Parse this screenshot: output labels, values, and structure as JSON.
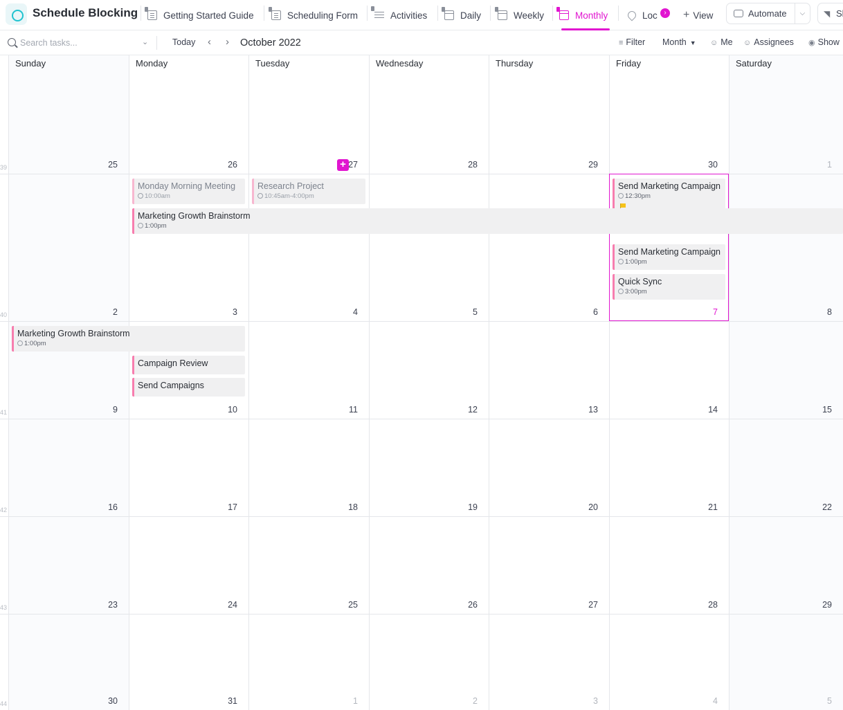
{
  "header": {
    "space_title": "Schedule Blocking",
    "tabs": [
      {
        "label": "Getting Started Guide"
      },
      {
        "label": "Scheduling Form"
      },
      {
        "label": "Activities"
      },
      {
        "label": "Daily"
      },
      {
        "label": "Weekly"
      },
      {
        "label": "Monthly",
        "active": true
      },
      {
        "label": "Loc"
      }
    ],
    "more_badge": "›",
    "add_view_label": "View",
    "automate_label": "Automate",
    "share_label": "Sh"
  },
  "toolbar": {
    "search_placeholder": "Search tasks...",
    "today_label": "Today",
    "month_title": "October 2022",
    "filter_label": "Filter",
    "period_label": "Month",
    "me_label": "Me",
    "assignees_label": "Assignees",
    "show_label": "Show"
  },
  "calendar": {
    "weekdays": [
      "Sunday",
      "Monday",
      "Tuesday",
      "Wednesday",
      "Thursday",
      "Friday",
      "Saturday"
    ],
    "week_numbers": [
      "39",
      "40",
      "41",
      "42",
      "43",
      "44"
    ],
    "weeks": [
      [
        "25",
        "26",
        "27",
        "28",
        "29",
        "30",
        "1"
      ],
      [
        "2",
        "3",
        "4",
        "5",
        "6",
        "7",
        "8"
      ],
      [
        "9",
        "10",
        "11",
        "12",
        "13",
        "14",
        "15"
      ],
      [
        "16",
        "17",
        "18",
        "19",
        "20",
        "21",
        "22"
      ],
      [
        "23",
        "24",
        "25",
        "26",
        "27",
        "28",
        "29"
      ],
      [
        "30",
        "31",
        "1",
        "2",
        "3",
        "4",
        "5"
      ]
    ],
    "today": "7"
  },
  "events": [
    {
      "title": "Monday Morning Meeting",
      "time": "10:00am",
      "past": true
    },
    {
      "title": "Research Project",
      "time": "10:45am-4:00pm",
      "past": true
    },
    {
      "title": "Send Marketing Campaign",
      "time": "12:30pm",
      "flag": "priority-flag-yellow"
    },
    {
      "title": "Marketing Growth Brainstorm",
      "time": "1:00pm"
    },
    {
      "title": "Send Marketing Campaign",
      "time": "1:00pm"
    },
    {
      "title": "Quick Sync",
      "time": "3:00pm"
    },
    {
      "title": "Marketing Growth Brainstorm",
      "time": "1:00pm"
    },
    {
      "title": "Campaign Review",
      "time": ""
    },
    {
      "title": "Send Campaigns",
      "time": ""
    }
  ],
  "colors": {
    "accent": "#e115d0",
    "event_bar": "#f77dae",
    "event_bg": "#f0f0f1",
    "logo": "#1fc3d0"
  }
}
